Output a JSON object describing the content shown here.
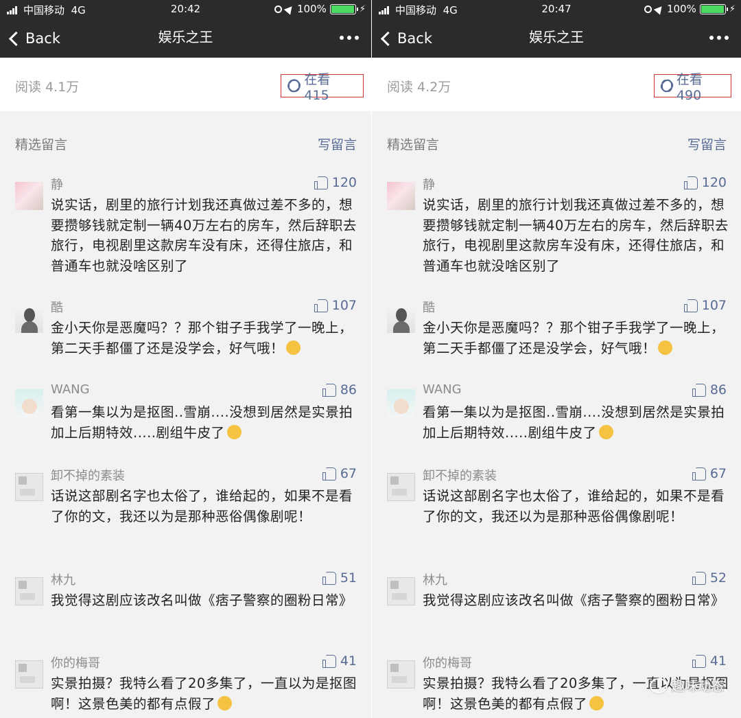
{
  "panels": [
    {
      "status": {
        "carrier": "中国移动",
        "network": "4G",
        "time": "20:42",
        "battery": "100%"
      },
      "nav": {
        "back": "Back",
        "title": "娱乐之王"
      },
      "reads": "阅读 4.1万",
      "zaikan": "在看 415",
      "comments_label": "精选留言",
      "write_label": "写留言",
      "comments": [
        {
          "name": "静",
          "likes": "120",
          "text": "说实话，剧里的旅行计划我还真做过差不多的，想要攒够钱就定制一辆40万左右的房车，然后辞职去旅行，电视剧里这款房车没有床，还得住旅店，和普通车也就没啥区别了"
        },
        {
          "name": "酷",
          "likes": "107",
          "text": "金小天你是恶魔吗？？那个钳子手我学了一晚上，第二天手都僵了还是没学会，好气哦！"
        },
        {
          "name": "WANG",
          "likes": "86",
          "text": "看第一集以为是抠图..雪崩....没想到居然是实景拍加上后期特效.....剧组牛皮了"
        },
        {
          "name": "卸不掉的素装",
          "likes": "67",
          "text": "话说这部剧名字也太俗了，谁给起的，如果不是看了你的文，我还以为是那种恶俗偶像剧呢！"
        },
        {
          "name": "林九",
          "likes": "51",
          "text": "我觉得这剧应该改名叫做《痞子警察的圈粉日常》"
        },
        {
          "name": "你的梅哥",
          "likes": "41",
          "text": "实景拍摄？我特么看了20多集了，一直以为是抠图啊！这景色美的都有点假了"
        }
      ]
    },
    {
      "status": {
        "carrier": "中国移动",
        "network": "4G",
        "time": "20:47",
        "battery": "100%"
      },
      "nav": {
        "back": "Back",
        "title": "娱乐之王"
      },
      "reads": "阅读 4.2万",
      "zaikan": "在看 490",
      "comments_label": "精选留言",
      "write_label": "写留言",
      "comments": [
        {
          "name": "静",
          "likes": "120",
          "text": "说实话，剧里的旅行计划我还真做过差不多的，想要攒够钱就定制一辆40万左右的房车，然后辞职去旅行，电视剧里这款房车没有床，还得住旅店，和普通车也就没啥区别了"
        },
        {
          "name": "酷",
          "likes": "107",
          "text": "金小天你是恶魔吗？？那个钳子手我学了一晚上，第二天手都僵了还是没学会，好气哦！"
        },
        {
          "name": "WANG",
          "likes": "86",
          "text": "看第一集以为是抠图..雪崩....没想到居然是实景拍加上后期特效.....剧组牛皮了"
        },
        {
          "name": "卸不掉的素装",
          "likes": "67",
          "text": "话说这部剧名字也太俗了，谁给起的，如果不是看了你的文，我还以为是那种恶俗偶像剧呢！"
        },
        {
          "name": "林九",
          "likes": "52",
          "text": "我觉得这剧应该改名叫做《痞子警察的圈粉日常》"
        },
        {
          "name": "你的梅哥",
          "likes": "41",
          "text": "实景拍摄？我特么看了20多集了，一直以为是抠图啊！这景色美的都有点假了"
        }
      ],
      "watermark": "趣味动态"
    }
  ]
}
